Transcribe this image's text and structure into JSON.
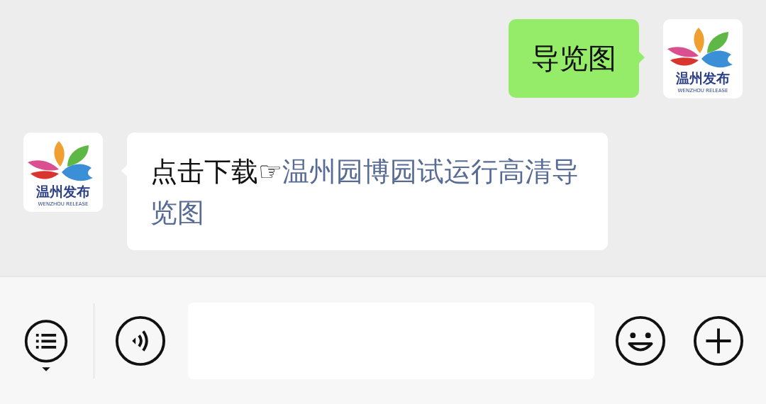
{
  "messages": [
    {
      "kind": "sent",
      "avatar": {
        "title": "温州发布",
        "subtitle": "WENZHOU RELEASE"
      },
      "parts": [
        {
          "kind": "text",
          "text": "导览图"
        }
      ]
    },
    {
      "kind": "received",
      "avatar": {
        "title": "温州发布",
        "subtitle": "WENZHOU RELEASE"
      },
      "parts": [
        {
          "kind": "text",
          "text": "点击下载☞"
        },
        {
          "kind": "link",
          "text": "温州园博园试运行高清导览图"
        }
      ]
    }
  ]
}
